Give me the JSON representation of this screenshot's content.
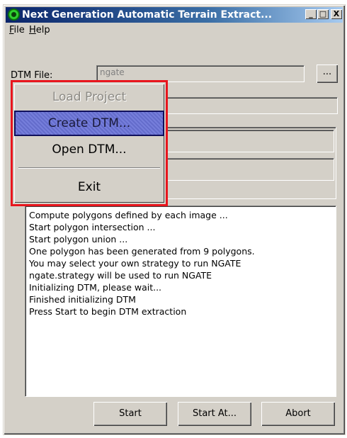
{
  "window": {
    "title": "Next Generation Automatic Terrain Extract...",
    "controls": {
      "minimize": "_",
      "maximize": "□",
      "close": "X"
    }
  },
  "menubar": {
    "file": {
      "mnemonic": "F",
      "rest": "ile"
    },
    "help": {
      "mnemonic": "H",
      "rest": "elp"
    }
  },
  "form": {
    "dtm_file_label": "DTM File:",
    "dtm_file_value": "ngate",
    "browse_label": "...",
    "strategy_value": "ngate.strategy"
  },
  "file_menu": {
    "items": [
      {
        "label": "Load Project",
        "state": "disabled"
      },
      {
        "label": "Create DTM...",
        "state": "highlighted"
      },
      {
        "label": "Open DTM...",
        "state": "enabled"
      },
      {
        "label": "Exit",
        "state": "enabled"
      }
    ],
    "highlight_color": "#6a73d8",
    "annotation_color": "#e8151d"
  },
  "log": {
    "lines": [
      "Compute polygons defined by each image ...",
      "Start polygon intersection ...",
      "Start polygon union ...",
      "One polygon has been generated from 9 polygons.",
      "You may select your own strategy to run NGATE",
      "ngate.strategy will be used to run NGATE",
      "Initializing DTM, please wait...",
      "Finished initializing DTM",
      "Press  Start  to begin DTM extraction"
    ]
  },
  "buttons": {
    "start": "Start",
    "start_at": "Start At...",
    "abort": "Abort"
  },
  "icons": {
    "app": "green-ring-app-icon"
  },
  "colors": {
    "title_gradient_start": "#0a246a",
    "title_gradient_end": "#a6caf0",
    "face": "#d4d0c8"
  }
}
